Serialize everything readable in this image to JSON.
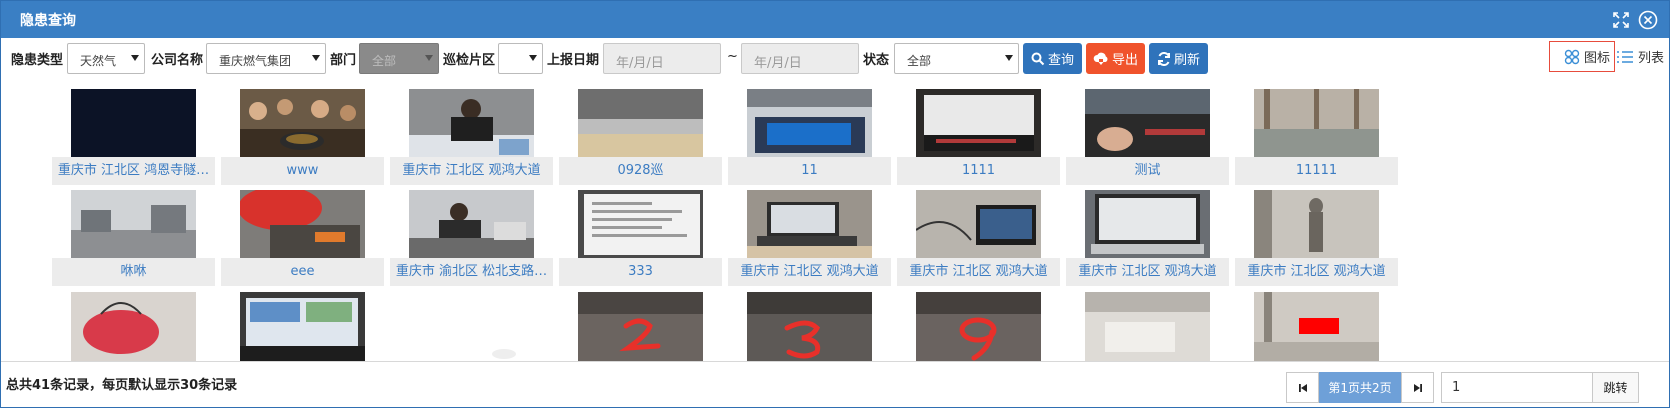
{
  "window": {
    "title": "隐患查询"
  },
  "filters": {
    "hazard_type": {
      "label": "隐患类型",
      "value": "天然气"
    },
    "company": {
      "label": "公司名称",
      "value": "重庆燃气集团"
    },
    "department": {
      "label": "部门",
      "value": "全部"
    },
    "patrol_area": {
      "label": "巡检片区",
      "value": ""
    },
    "report_date": {
      "label": "上报日期",
      "start_placeholder": "年/月/日",
      "separator": "~",
      "end_placeholder": "年/月/日"
    },
    "status": {
      "label": "状态",
      "value": "全部"
    }
  },
  "actions": {
    "query": "查询",
    "export": "导出",
    "refresh": "刷新"
  },
  "view_modes": {
    "icon": "图标",
    "list": "列表"
  },
  "colors": {
    "titlebar": "#3a7fc4",
    "query": "#2f73bb",
    "export": "#f0532c",
    "refresh": "#2f73bb",
    "caption_text": "#3c7cc2",
    "pager_active": "#6ea0d8"
  },
  "tiles": [
    {
      "caption": "重庆市 江北区 鸿恩寺隧…",
      "photo": "dark-night-photo"
    },
    {
      "caption": "www",
      "photo": "group-dinner-photo"
    },
    {
      "caption": "重庆市 江北区 观鸿大道",
      "photo": "office-person-photo"
    },
    {
      "caption": "0928巡",
      "photo": "desk-edge-photo"
    },
    {
      "caption": "11",
      "photo": "laptop-keyboard-photo"
    },
    {
      "caption": "1111",
      "photo": "monitor-photo"
    },
    {
      "caption": "测试",
      "photo": "hand-keyboard-photo"
    },
    {
      "caption": "11111",
      "photo": "window-view-photo"
    },
    {
      "caption": "咻咻",
      "photo": "office-corridor-photo"
    },
    {
      "caption": "eee",
      "photo": "red-cap-photo"
    },
    {
      "caption": "重庆市 渝北区 松北支路…",
      "photo": "office-desk-photo"
    },
    {
      "caption": "333",
      "photo": "screen-document-photo"
    },
    {
      "caption": "重庆市 江北区 观鸿大道",
      "photo": "laptop-desk-photo"
    },
    {
      "caption": "重庆市 江北区 观鸿大道",
      "photo": "laptop-cables-photo"
    },
    {
      "caption": "重庆市 江北区 观鸿大道",
      "photo": "macbook-photo"
    },
    {
      "caption": "重庆市 江北区 观鸿大道",
      "photo": "statue-photo"
    },
    {
      "caption": "",
      "photo": "red-bag-photo"
    },
    {
      "caption": "",
      "photo": "laptop-screen-photo"
    },
    {
      "caption": "",
      "photo": "blank-photo"
    },
    {
      "caption": "",
      "photo": "handwritten-2-photo"
    },
    {
      "caption": "",
      "photo": "handwritten-3-photo"
    },
    {
      "caption": "",
      "photo": "handwritten-9-photo"
    },
    {
      "caption": "",
      "photo": "blurred-room-photo"
    },
    {
      "caption": "",
      "photo": "red-sign-photo"
    }
  ],
  "footer": {
    "total_text": "总共41条记录，每页默认显示30条记录",
    "page_info": "第1页共2页",
    "page_input_value": "1",
    "jump_label": "跳转"
  }
}
